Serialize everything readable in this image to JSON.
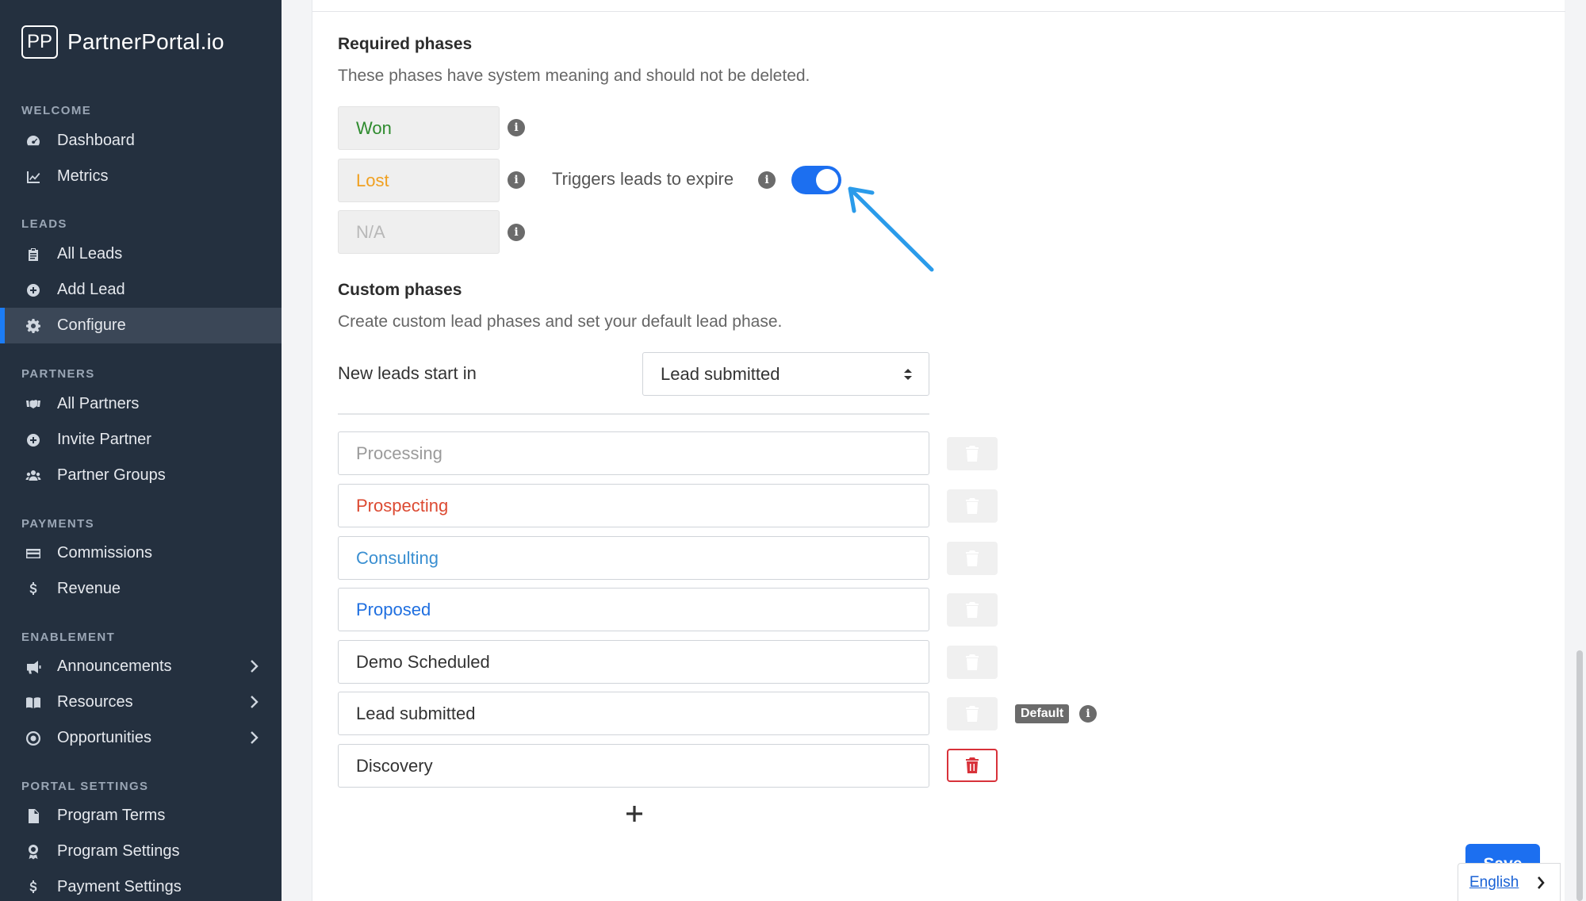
{
  "brand": {
    "logo_text": "PP",
    "name": "PartnerPortal.io"
  },
  "sidebar": {
    "sections": [
      {
        "label": "WELCOME",
        "items": [
          {
            "label": "Dashboard",
            "icon": "dashboard-icon"
          },
          {
            "label": "Metrics",
            "icon": "chart-icon"
          }
        ]
      },
      {
        "label": "LEADS",
        "items": [
          {
            "label": "All Leads",
            "icon": "clipboard-icon"
          },
          {
            "label": "Add Lead",
            "icon": "plus-circle-icon"
          },
          {
            "label": "Configure",
            "icon": "gear-icon",
            "active": true
          }
        ]
      },
      {
        "label": "PARTNERS",
        "items": [
          {
            "label": "All Partners",
            "icon": "handshake-icon"
          },
          {
            "label": "Invite Partner",
            "icon": "plus-circle-icon"
          },
          {
            "label": "Partner Groups",
            "icon": "users-icon"
          }
        ]
      },
      {
        "label": "PAYMENTS",
        "items": [
          {
            "label": "Commissions",
            "icon": "credit-card-icon"
          },
          {
            "label": "Revenue",
            "icon": "dollar-icon"
          }
        ]
      },
      {
        "label": "ENABLEMENT",
        "items": [
          {
            "label": "Announcements",
            "icon": "megaphone-icon",
            "expandable": true
          },
          {
            "label": "Resources",
            "icon": "book-icon",
            "expandable": true
          },
          {
            "label": "Opportunities",
            "icon": "target-icon",
            "expandable": true
          }
        ]
      },
      {
        "label": "PORTAL SETTINGS",
        "items": [
          {
            "label": "Program Terms",
            "icon": "file-icon"
          },
          {
            "label": "Program Settings",
            "icon": "award-icon"
          },
          {
            "label": "Payment Settings",
            "icon": "dollar-icon"
          }
        ]
      }
    ]
  },
  "required": {
    "title": "Required phases",
    "description": "These phases have system meaning and should not be deleted.",
    "phases": [
      {
        "label": "Won",
        "color": "#2e8b2e"
      },
      {
        "label": "Lost",
        "color": "#f0a020"
      },
      {
        "label": "N/A",
        "color": "#b8b8b8"
      }
    ],
    "toggle_label": "Triggers leads to expire",
    "toggle_on": true
  },
  "custom": {
    "title": "Custom phases",
    "description": "Create custom lead phases and set your default lead phase.",
    "start_label": "New leads start in",
    "start_value": "Lead submitted",
    "phases": [
      {
        "label": "Processing",
        "color": "#9a9a9a"
      },
      {
        "label": "Prospecting",
        "color": "#dc4a32"
      },
      {
        "label": "Consulting",
        "color": "#3a8fd1"
      },
      {
        "label": "Proposed",
        "color": "#1f6fe0"
      },
      {
        "label": "Demo Scheduled",
        "color": "#333333"
      },
      {
        "label": "Lead submitted",
        "color": "#333333"
      },
      {
        "label": "Discovery",
        "color": "#333333"
      }
    ],
    "default_badge": "Default"
  },
  "actions": {
    "save_label": "Save"
  },
  "language": {
    "label": "English"
  },
  "colors": {
    "accent": "#1c6ff0",
    "sidebar_bg": "#24303f",
    "danger": "#d8323a"
  }
}
